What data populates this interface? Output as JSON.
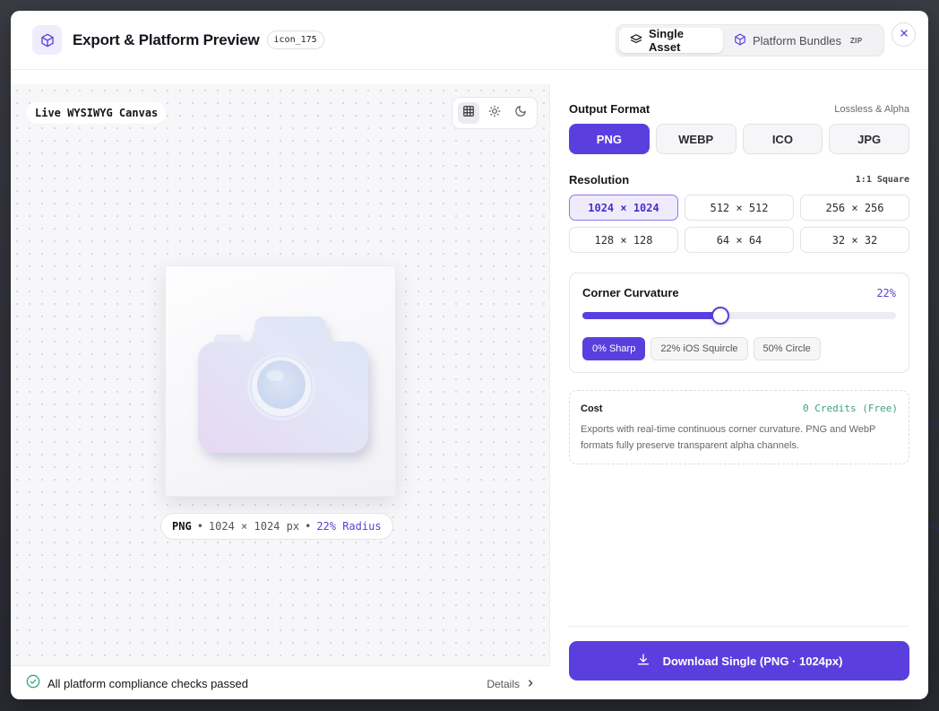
{
  "header": {
    "title": "Export & Platform Preview",
    "asset_id": "icon_175",
    "tabs": [
      {
        "label": "Single Asset",
        "active": true,
        "icon": "layers-icon"
      },
      {
        "label": "Platform Bundles",
        "badge": "ZIP",
        "active": false,
        "icon": "cube-icon"
      }
    ]
  },
  "canvas": {
    "label": "Live WYSIWYG Canvas",
    "tools": [
      "grid-icon",
      "sun-icon",
      "moon-icon"
    ],
    "meta": {
      "format": "PNG",
      "sep1": "•",
      "size": "1024 × 1024 px",
      "sep2": "•",
      "radius": "22% Radius"
    },
    "status": {
      "text": "All platform compliance checks passed",
      "details": "Details"
    }
  },
  "output": {
    "label": "Output Format",
    "hint": "Lossless & Alpha",
    "formats": [
      {
        "label": "PNG",
        "active": true
      },
      {
        "label": "WEBP",
        "active": false
      },
      {
        "label": "ICO",
        "active": false
      },
      {
        "label": "JPG",
        "active": false
      }
    ]
  },
  "resolution": {
    "label": "Resolution",
    "hint": "1:1 Square",
    "options": [
      {
        "label": "1024 × 1024",
        "active": true
      },
      {
        "label": "512 × 512",
        "active": false
      },
      {
        "label": "256 × 256",
        "active": false
      },
      {
        "label": "128 × 128",
        "active": false
      },
      {
        "label": "64 × 64",
        "active": false
      },
      {
        "label": "32 × 32",
        "active": false
      }
    ]
  },
  "curvature": {
    "label": "Corner Curvature",
    "value_text": "22%",
    "slider_fraction": 0.44,
    "presets": [
      {
        "label": "0% Sharp",
        "active": true
      },
      {
        "label": "22% iOS Squircle",
        "active": false
      },
      {
        "label": "50% Circle",
        "active": false
      }
    ]
  },
  "cost": {
    "title": "Cost",
    "value": "0 Credits (Free)",
    "description": "Exports with real-time continuous corner curvature. PNG and WebP formats fully preserve transparent alpha channels."
  },
  "download": {
    "label": "Download Single (PNG · 1024px)"
  },
  "colors": {
    "accent": "#5b3fde",
    "success": "#3da37a"
  }
}
